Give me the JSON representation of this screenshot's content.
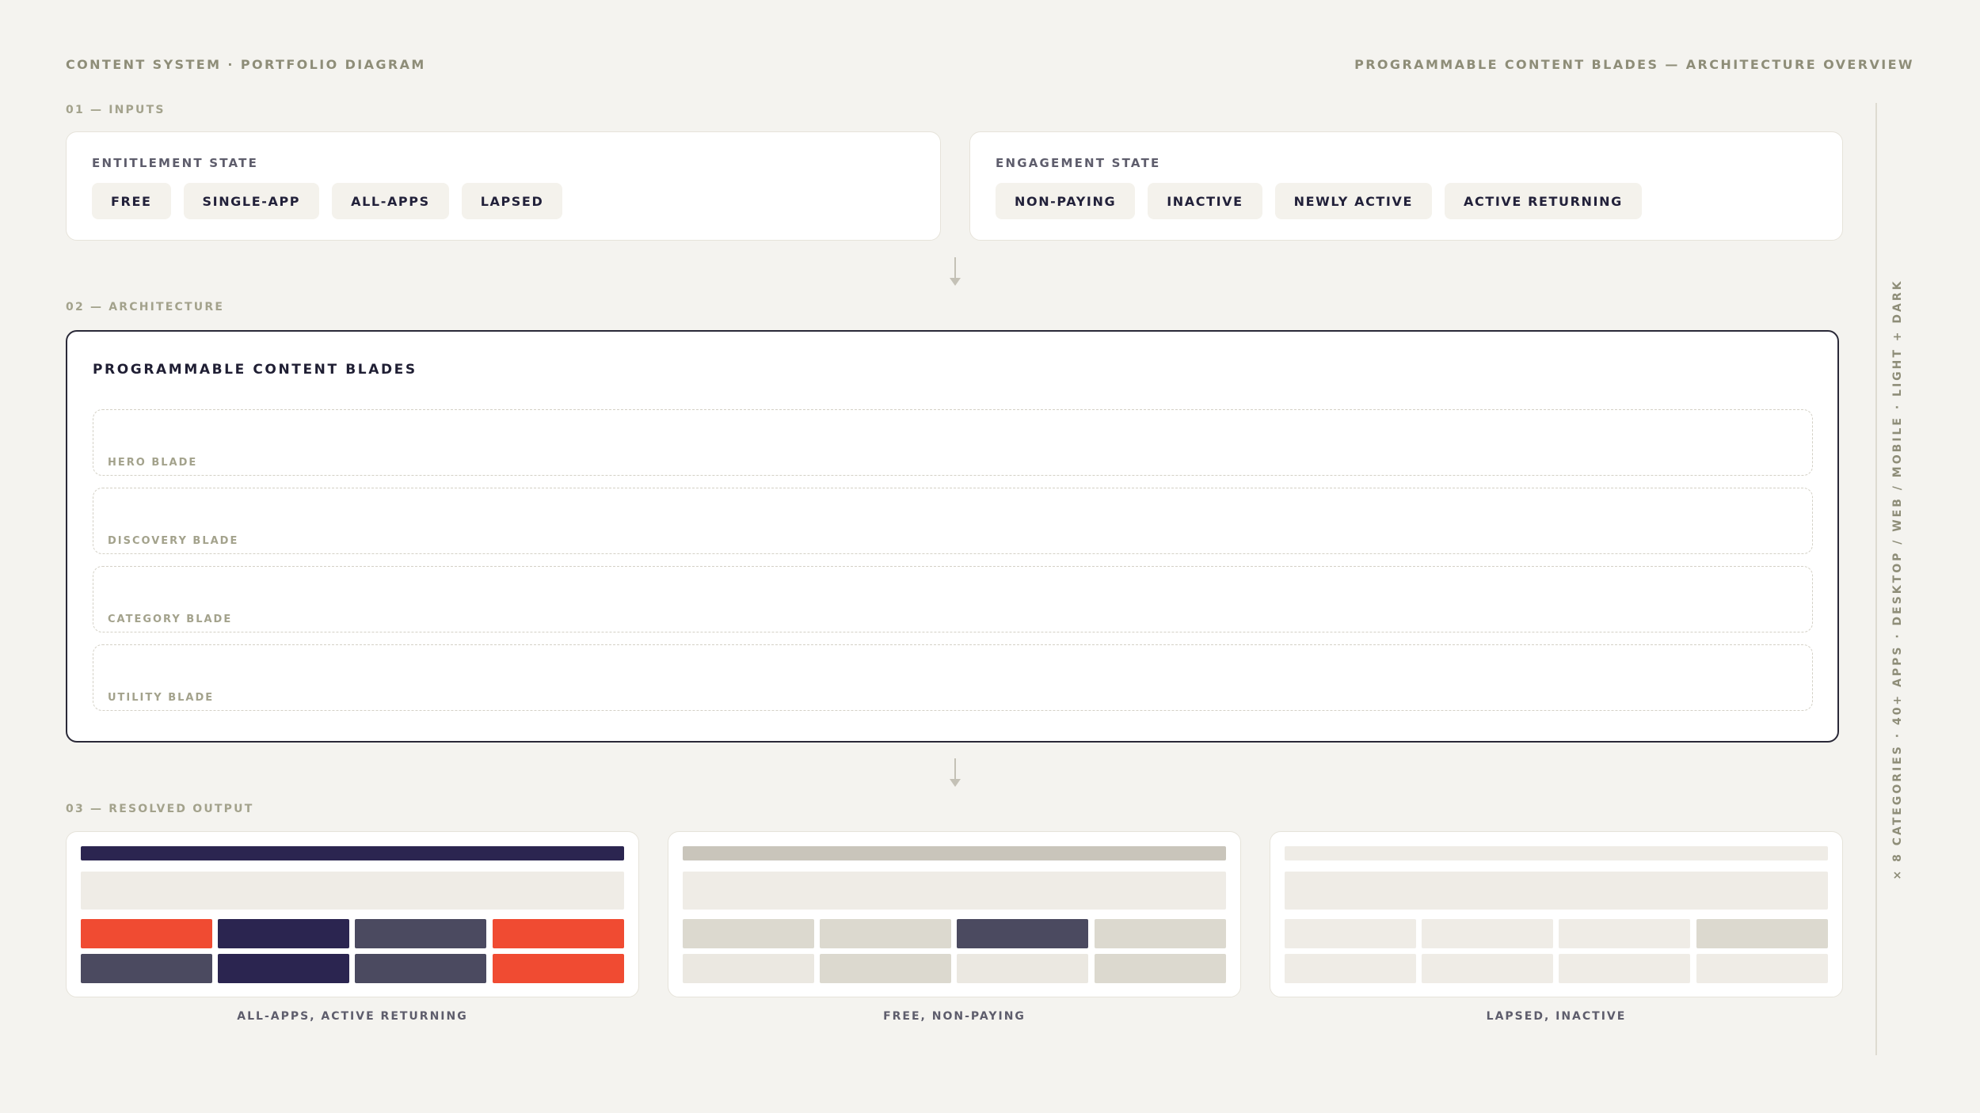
{
  "header": {
    "left": "CONTENT SYSTEM · PORTFOLIO DIAGRAM",
    "right": "PROGRAMMABLE CONTENT BLADES — ARCHITECTURE OVERVIEW"
  },
  "sections": {
    "inputs": "01 — INPUTS",
    "architecture": "02 — ARCHITECTURE",
    "output": "03 — RESOLVED OUTPUT"
  },
  "entitlement": {
    "title": "ENTITLEMENT STATE",
    "chips": [
      "FREE",
      "SINGLE-APP",
      "ALL-APPS",
      "LAPSED"
    ]
  },
  "engagement": {
    "title": "ENGAGEMENT STATE",
    "chips": [
      "NON-PAYING",
      "INACTIVE",
      "NEWLY ACTIVE",
      "ACTIVE RETURNING"
    ]
  },
  "architecture": {
    "title": "PROGRAMMABLE CONTENT BLADES",
    "blades": [
      "HERO BLADE",
      "DISCOVERY BLADE",
      "CATEGORY BLADE",
      "UTILITY BLADE"
    ]
  },
  "outputs": [
    {
      "caption": "ALL-APPS, ACTIVE RETURNING",
      "bar_color": "#2b2550",
      "tiles": [
        "#f04b32",
        "#2b2550",
        "#4b4a60",
        "#f04b32",
        "#4b4a60",
        "#2b2550",
        "#4b4a60",
        "#f04b32"
      ]
    },
    {
      "caption": "FREE, NON-PAYING",
      "bar_color": "#c9c5bb",
      "tiles": [
        "#dcd9cf",
        "#dcd9cf",
        "#4b4a60",
        "#dcd9cf",
        "#ebe8e1",
        "#dcd9cf",
        "#ebe8e1",
        "#dcd9cf"
      ]
    },
    {
      "caption": "LAPSED, INACTIVE",
      "bar_color": "#efece6",
      "tiles": [
        "#efece6",
        "#efece6",
        "#efece6",
        "#dcd9cf",
        "#efece6",
        "#efece6",
        "#efece6",
        "#efece6"
      ]
    }
  ],
  "sidebar_note": "× 8 CATEGORIES · 40+ APPS · DESKTOP / WEB / MOBILE · LIGHT + DARK"
}
